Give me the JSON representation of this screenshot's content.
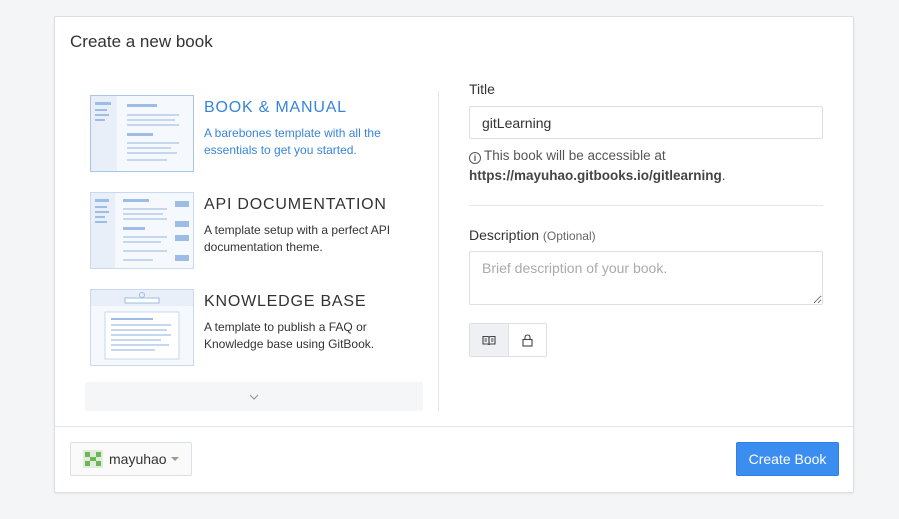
{
  "panel": {
    "title": "Create a new book"
  },
  "templates": [
    {
      "title": "BOOK & MANUAL",
      "description": "A barebones template with all the essentials to get you started.",
      "active": true
    },
    {
      "title": "API DOCUMENTATION",
      "description": "A template setup with a perfect API documentation theme.",
      "active": false
    },
    {
      "title": "KNOWLEDGE BASE",
      "description": "A template to publish a FAQ or Knowledge base using GitBook.",
      "active": false
    }
  ],
  "more_templates": {
    "icon": "chevron-down-icon",
    "glyph": "⌄"
  },
  "form": {
    "title_label": "Title",
    "title_value": "gitLearning",
    "hint_prefix": "This book will be accessible at",
    "hint_url": "https://mayuhao.gitbooks.io/gitlearning",
    "hint_suffix": ".",
    "description_label": "Description",
    "description_optional": "(Optional)",
    "description_placeholder": "Brief description of your book.",
    "visibility": [
      {
        "icon": "open-book-icon",
        "active": true
      },
      {
        "icon": "lock-icon",
        "active": false
      }
    ]
  },
  "footer": {
    "owner_name": "mayuhao",
    "create_label": "Create Book"
  },
  "colors": {
    "accent": "#3884d9",
    "primary_button": "#3b8ef0"
  }
}
